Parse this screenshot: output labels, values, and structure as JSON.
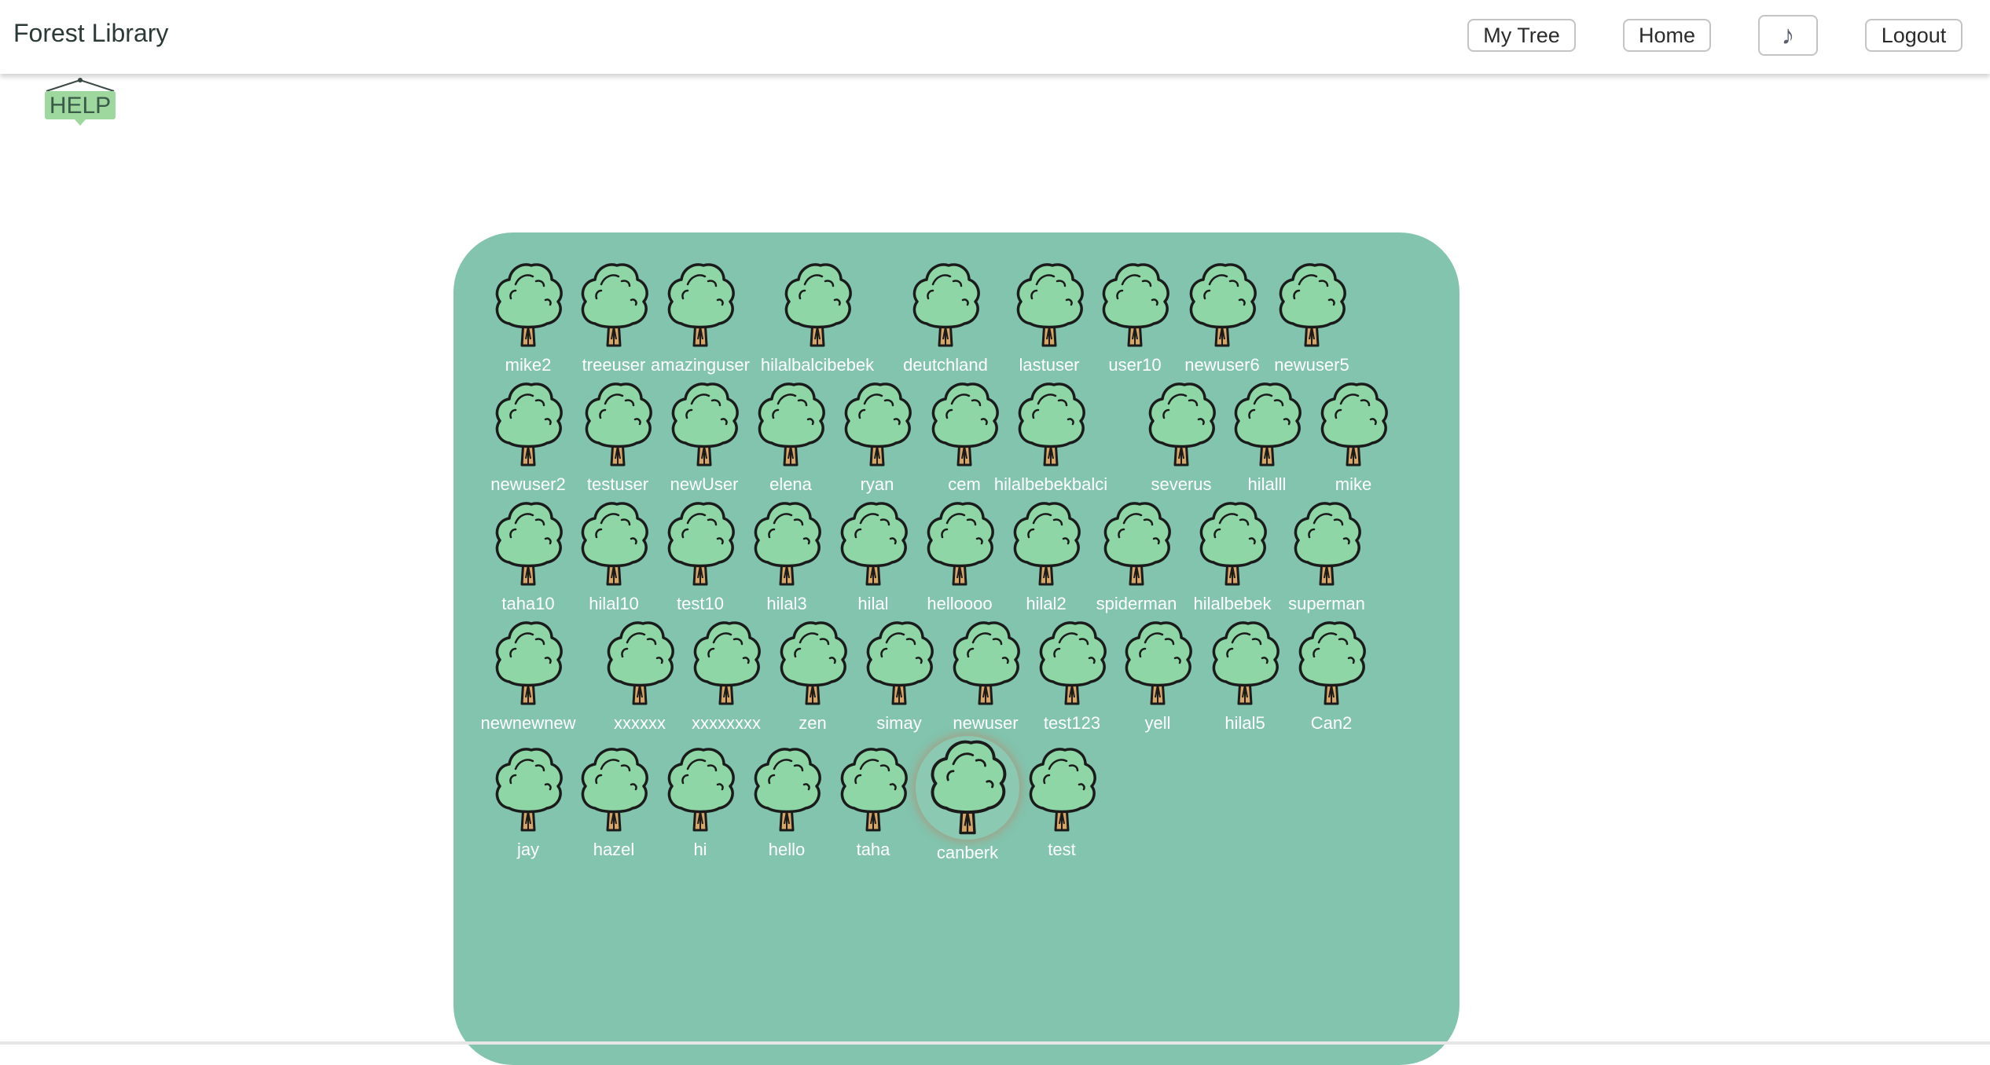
{
  "header": {
    "brand": "Forest Library",
    "nav": {
      "my_tree": "My Tree",
      "home": "Home",
      "music": "♪",
      "logout": "Logout"
    }
  },
  "help": {
    "label": "HELP"
  },
  "colors": {
    "forest_bg": "#82c4ae",
    "leaf": "#8ed6a6",
    "trunk": "#d7a667",
    "outline": "#1b1b1b"
  },
  "trees": [
    [
      "mike2",
      "treeuser",
      "amazinguser",
      "hilalbalcibebek",
      "deutchland",
      "lastuser",
      "user10",
      "newuser6",
      "newuser5"
    ],
    [
      "newuser2",
      "testuser",
      "newUser",
      "elena",
      "ryan",
      "cem",
      "hilalbebekbalci",
      "severus",
      "hilalll",
      "mike"
    ],
    [
      "taha10",
      "hilal10",
      "test10",
      "hilal3",
      "hilal",
      "helloooo",
      "hilal2",
      "spiderman",
      "hilalbebek",
      "superman"
    ],
    [
      "newnewnew",
      "xxxxxx",
      "xxxxxxxx",
      "zen",
      "simay",
      "newuser",
      "test123",
      "yell",
      "hilal5",
      "Can2"
    ],
    [
      "jay",
      "hazel",
      "hi",
      "hello",
      "taha",
      "canberk",
      "test"
    ]
  ],
  "selected_tree": "canberk"
}
